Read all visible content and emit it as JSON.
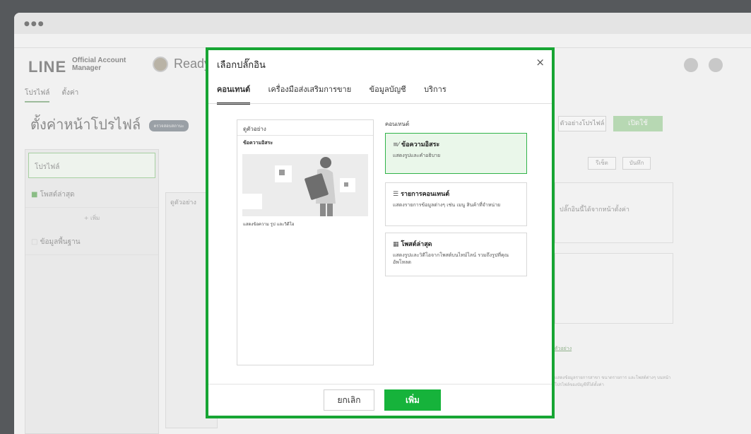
{
  "window": {
    "dots": "●●●"
  },
  "app": {
    "logo_main": "LINE",
    "logo_sub": "Official Account Manager",
    "account_name": "Ready",
    "top_tabs": [
      "โปรไฟล์",
      "ตั้งค่า"
    ],
    "page_title": "ตั้งค่าหน้าโปรไฟล์",
    "title_badge": "ตรวจสอบสถานะ",
    "preview_button": "ตัวอย่างโปรไฟล์",
    "publish_button": "เปิดใช้",
    "sidebar": {
      "profile": "โปรไฟล์",
      "latest_posts": "โพสต์ล่าสุด",
      "add": "+ เพิ่ม",
      "basic_info": "ข้อมูลพื้นฐาน"
    },
    "preview_label": "ดูตัวอย่าง",
    "reset_button": "รีเซ็ต",
    "save_button": "บันทึก",
    "card_text": "ปลั๊กอินนี้ได้จากหน้าตั้งค่า",
    "link_text": "ตัวอย่าง",
    "small_note": "แสดงข้อมูลรายการสาขา ขนาดรายการ และโพสต์ต่างๆ บนหน้าโปรไฟล์ของบัญชีที่ได้ตั้งค่า"
  },
  "modal": {
    "title": "เลือกปลั๊กอิน",
    "close": "×",
    "tabs": [
      "คอนเทนต์",
      "เครื่องมือส่งเสริมการขาย",
      "ข้อมูลบัญชี",
      "บริการ"
    ],
    "preview": {
      "header": "ดูตัวอย่าง",
      "subtitle": "ข้อความอิสระ",
      "caption": "แสดงข้อความ รูป และวิดีโอ"
    },
    "content_label": "คอนเทนต์",
    "options": [
      {
        "icon": "≡⁄",
        "title": "ข้อความอิสระ",
        "desc": "แสดงรูปและคำอธิบาย"
      },
      {
        "icon": "☰",
        "title": "รายการคอนเทนต์",
        "desc": "แสดงรายการข้อมูลต่างๆ เช่น เมนู สินค้าที่จำหน่าย"
      },
      {
        "icon": "▦",
        "title": "โพสต์ล่าสุด",
        "desc": "แสดงรูปและวิดีโอจากโพสต์บนไทม์ไลน์ รวมถึงรูปที่คุณอัพโหลด"
      }
    ],
    "cancel_label": "ยกเลิก",
    "add_label": "เพิ่ม"
  }
}
